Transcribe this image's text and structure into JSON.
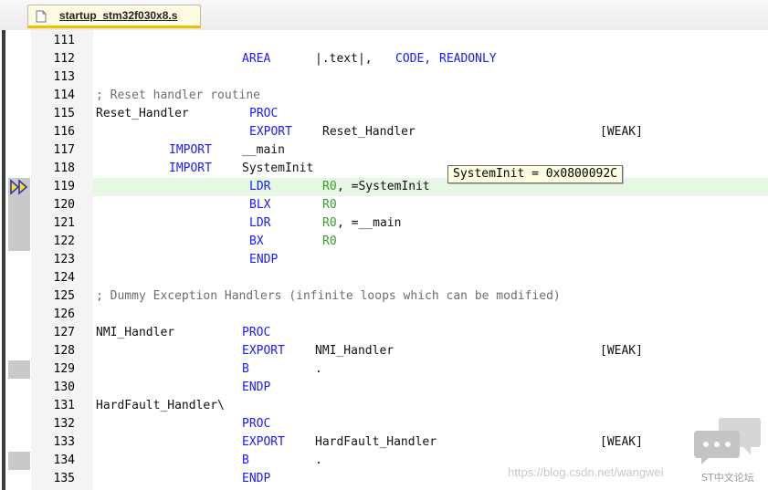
{
  "tab": {
    "filename": "startup_stm32f030x8.s",
    "icon": "document-icon"
  },
  "tooltip": {
    "text": "SystemInit = 0x0800092C"
  },
  "watermark": {
    "url": "https://blog.csdn.net/wangwei",
    "brand": "ST中文论坛"
  },
  "colors": {
    "keyword": "#1a1aff",
    "register": "#3a9a2e",
    "comment": "#6e6e6e",
    "current_line": "#e6f7e4",
    "tab_accent": "#f0c000"
  },
  "lines": [
    {
      "num": "111",
      "parts": []
    },
    {
      "num": "112",
      "parts": [
        {
          "t": "AREA",
          "c": "kw",
          "col": 20
        },
        {
          "t": "|.text|,",
          "c": "plain",
          "col": 30
        },
        {
          "t": "CODE,",
          "c": "kw",
          "col": 41
        },
        {
          "t": "READONLY",
          "c": "kw",
          "col": 47
        }
      ]
    },
    {
      "num": "113",
      "parts": []
    },
    {
      "num": "114",
      "parts": [
        {
          "t": "; Reset handler routine",
          "c": "cm",
          "col": 0
        }
      ]
    },
    {
      "num": "115",
      "parts": [
        {
          "t": "Reset_Handler",
          "c": "plain",
          "col": 0
        },
        {
          "t": "PROC",
          "c": "kw",
          "col": 21
        }
      ]
    },
    {
      "num": "116",
      "parts": [
        {
          "t": "EXPORT",
          "c": "kw",
          "col": 21
        },
        {
          "t": "Reset_Handler",
          "c": "plain",
          "col": 31
        },
        {
          "t": "[WEAK]",
          "c": "plain",
          "col": 69
        }
      ]
    },
    {
      "num": "117",
      "parts": [
        {
          "t": "IMPORT",
          "c": "kw",
          "col": 10
        },
        {
          "t": "__main",
          "c": "plain",
          "col": 20
        }
      ]
    },
    {
      "num": "118",
      "parts": [
        {
          "t": "IMPORT",
          "c": "kw",
          "col": 10
        },
        {
          "t": "SystemInit",
          "c": "plain",
          "col": 20
        }
      ]
    },
    {
      "num": "119",
      "current": true,
      "parts": [
        {
          "t": "LDR",
          "c": "kw",
          "col": 21
        },
        {
          "t": "R0",
          "c": "reg",
          "col": 31
        },
        {
          "t": ", =SystemInit",
          "c": "plain",
          "col": 33
        }
      ]
    },
    {
      "num": "120",
      "parts": [
        {
          "t": "BLX",
          "c": "kw",
          "col": 21
        },
        {
          "t": "R0",
          "c": "reg",
          "col": 31
        }
      ]
    },
    {
      "num": "121",
      "parts": [
        {
          "t": "LDR",
          "c": "kw",
          "col": 21
        },
        {
          "t": "R0",
          "c": "reg",
          "col": 31
        },
        {
          "t": ", =__main",
          "c": "plain",
          "col": 33
        }
      ]
    },
    {
      "num": "122",
      "parts": [
        {
          "t": "BX",
          "c": "kw",
          "col": 21
        },
        {
          "t": "R0",
          "c": "reg",
          "col": 31
        }
      ]
    },
    {
      "num": "123",
      "parts": [
        {
          "t": "ENDP",
          "c": "kw",
          "col": 21
        }
      ]
    },
    {
      "num": "124",
      "parts": []
    },
    {
      "num": "125",
      "parts": [
        {
          "t": "; Dummy Exception Handlers (infinite loops which can be modified)",
          "c": "cm",
          "col": 0
        }
      ]
    },
    {
      "num": "126",
      "parts": []
    },
    {
      "num": "127",
      "parts": [
        {
          "t": "NMI_Handler",
          "c": "plain",
          "col": 0
        },
        {
          "t": "PROC",
          "c": "kw",
          "col": 20
        }
      ]
    },
    {
      "num": "128",
      "parts": [
        {
          "t": "EXPORT",
          "c": "kw",
          "col": 20
        },
        {
          "t": "NMI_Handler",
          "c": "plain",
          "col": 30
        },
        {
          "t": "[WEAK]",
          "c": "plain",
          "col": 69
        }
      ]
    },
    {
      "num": "129",
      "parts": [
        {
          "t": "B",
          "c": "kw",
          "col": 20
        },
        {
          "t": ".",
          "c": "plain",
          "col": 30
        }
      ]
    },
    {
      "num": "130",
      "parts": [
        {
          "t": "ENDP",
          "c": "kw",
          "col": 20
        }
      ]
    },
    {
      "num": "131",
      "parts": [
        {
          "t": "HardFault_Handler\\",
          "c": "plain",
          "col": 0
        }
      ]
    },
    {
      "num": "132",
      "parts": [
        {
          "t": "PROC",
          "c": "kw",
          "col": 20
        }
      ]
    },
    {
      "num": "133",
      "parts": [
        {
          "t": "EXPORT",
          "c": "kw",
          "col": 20
        },
        {
          "t": "HardFault_Handler",
          "c": "plain",
          "col": 30
        },
        {
          "t": "[WEAK]",
          "c": "plain",
          "col": 69
        }
      ]
    },
    {
      "num": "134",
      "parts": [
        {
          "t": "B",
          "c": "kw",
          "col": 20
        },
        {
          "t": ".",
          "c": "plain",
          "col": 30
        }
      ]
    },
    {
      "num": "135",
      "parts": [
        {
          "t": "ENDP",
          "c": "kw",
          "col": 20
        }
      ]
    }
  ],
  "gutter_markers": [
    "119",
    "120",
    "121",
    "122",
    "129",
    "134"
  ]
}
